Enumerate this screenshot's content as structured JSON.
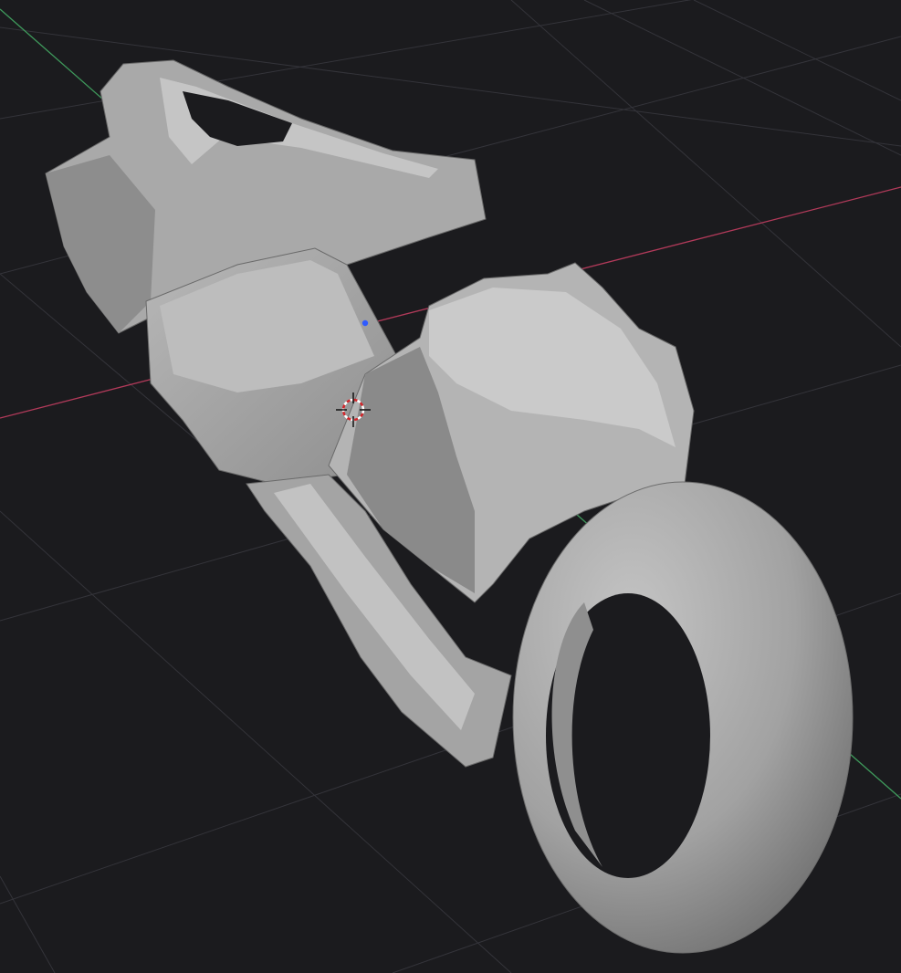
{
  "viewport": {
    "background_color": "#1b1b1e",
    "grid_color": "#34343a",
    "x_axis_color": "#b23a5a",
    "y_axis_color": "#3f9a5c",
    "origin_color": "#2f5bff",
    "model_color": "#a9a9a9",
    "model_shadow_color": "#5d5d5d",
    "model_highlight_color": "#c9c9c9"
  },
  "cursor": {
    "icon": "3d-cursor-icon"
  }
}
